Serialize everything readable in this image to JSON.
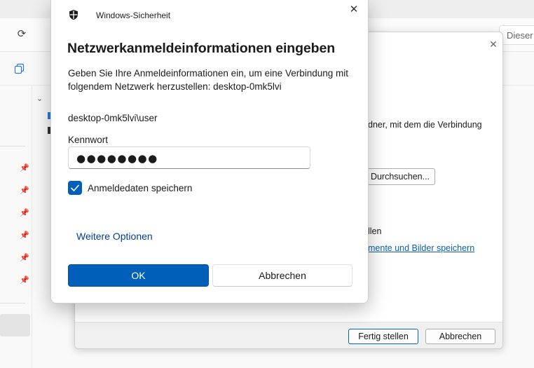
{
  "explorer": {
    "search_placeholder": "Dieser"
  },
  "wizard": {
    "text_connection": "dner, mit dem die Verbindung",
    "browse_label": "Durchsuchen...",
    "text_line2": "llen",
    "link_text": "mente und Bilder speichern",
    "finish_label": "Fertig stellen",
    "cancel_label": "Abbrechen"
  },
  "dialog": {
    "app_title": "Windows-Sicherheit",
    "heading": "Netzwerkanmeldeinformationen eingeben",
    "description": "Geben Sie Ihre Anmeldeinformationen ein, um eine Verbindung mit folgendem Netzwerk herzustellen: desktop-0mk5lvi",
    "username": "desktop-0mk5lvi\\user",
    "password_label": "Kennwort",
    "password_value": "●●●●●●●●",
    "remember_label": "Anmeldedaten speichern",
    "remember_checked": true,
    "more_options_label": "Weitere Optionen",
    "ok_label": "OK",
    "cancel_label": "Abbrechen"
  },
  "icons": {
    "refresh": "refresh-icon",
    "copy": "copy-icon",
    "pin": "pin-icon",
    "shield": "shield-icon",
    "close": "close-icon",
    "check": "check-icon",
    "chevron": "chevron-down-icon"
  },
  "colors": {
    "accent": "#005fb8",
    "link": "#003e92"
  }
}
